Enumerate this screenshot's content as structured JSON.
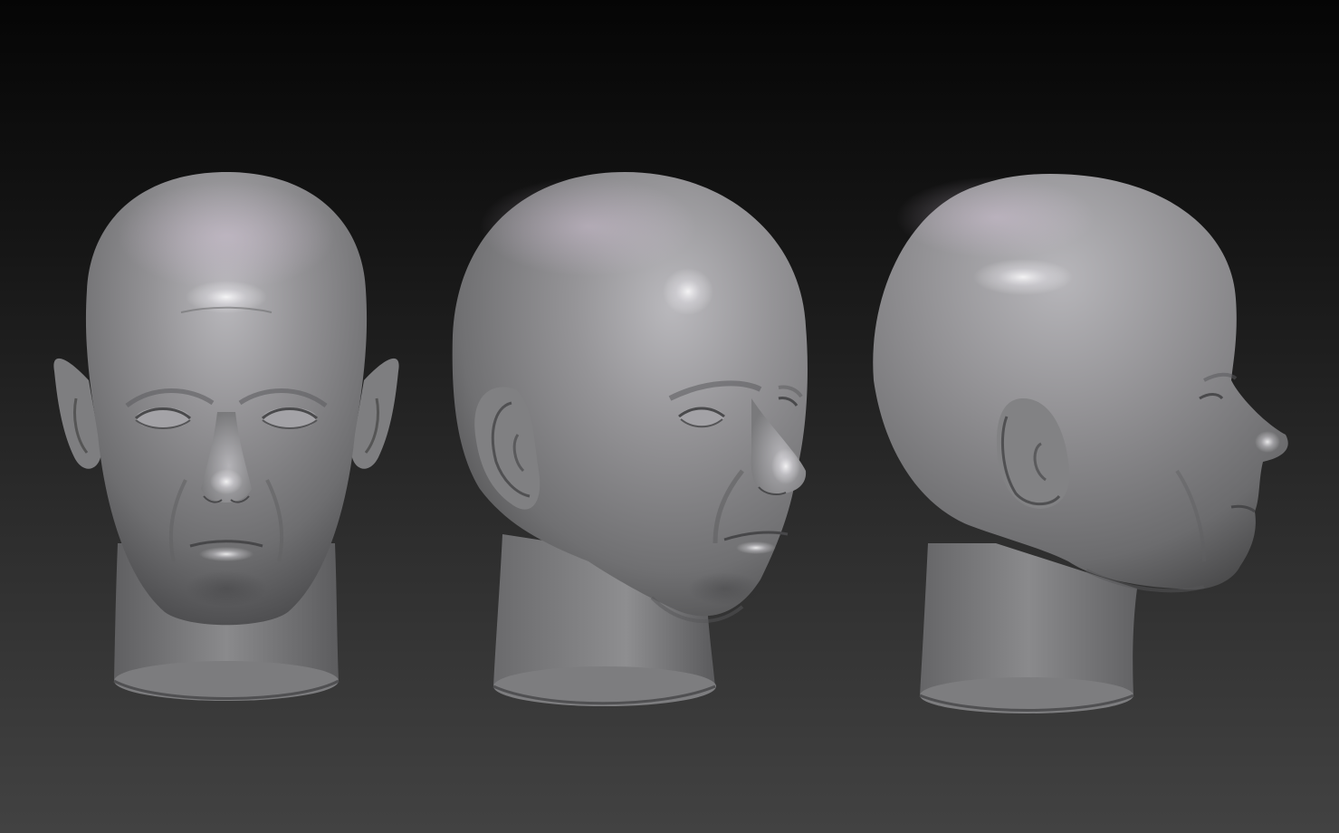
{
  "scene": {
    "background_top": "#050505",
    "background_bottom": "#424242",
    "material": "matcap-grey-clay",
    "material_color": "#8c8c8e",
    "highlight_color": "#e6e4ea",
    "views": [
      {
        "name": "front-view"
      },
      {
        "name": "three-quarter-view"
      },
      {
        "name": "side-view"
      }
    ]
  }
}
